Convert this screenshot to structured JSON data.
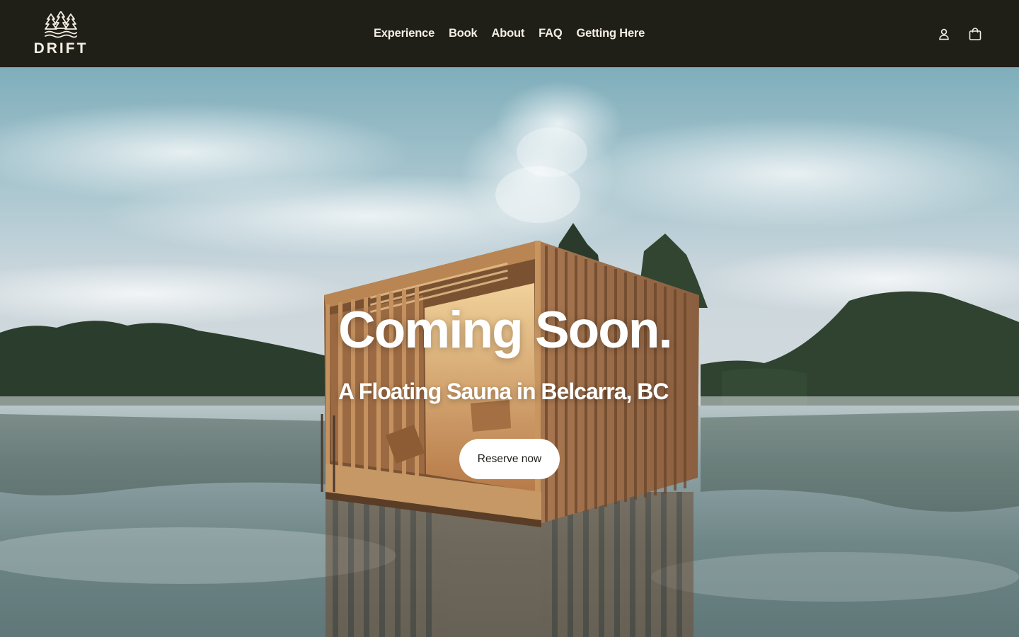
{
  "brand": {
    "name": "DRIFT",
    "logo_icon": "trees-over-waves-icon"
  },
  "nav": {
    "items": [
      {
        "label": "Experience"
      },
      {
        "label": "Book"
      },
      {
        "label": "About"
      },
      {
        "label": "FAQ"
      },
      {
        "label": "Getting Here"
      }
    ]
  },
  "header_icons": {
    "account": "user-icon",
    "cart": "shopping-bag-icon"
  },
  "hero": {
    "title": "Coming Soon.",
    "subtitle": "A Floating Sauna in Belcarra, BC",
    "cta_label": "Reserve now",
    "background": "floating-sauna-on-lake-photo"
  },
  "colors": {
    "header_bg": "#1f1e17",
    "header_text": "#f5efe3",
    "cta_bg": "#ffffff",
    "cta_text": "#1f1e17",
    "hero_text": "#ffffff"
  }
}
